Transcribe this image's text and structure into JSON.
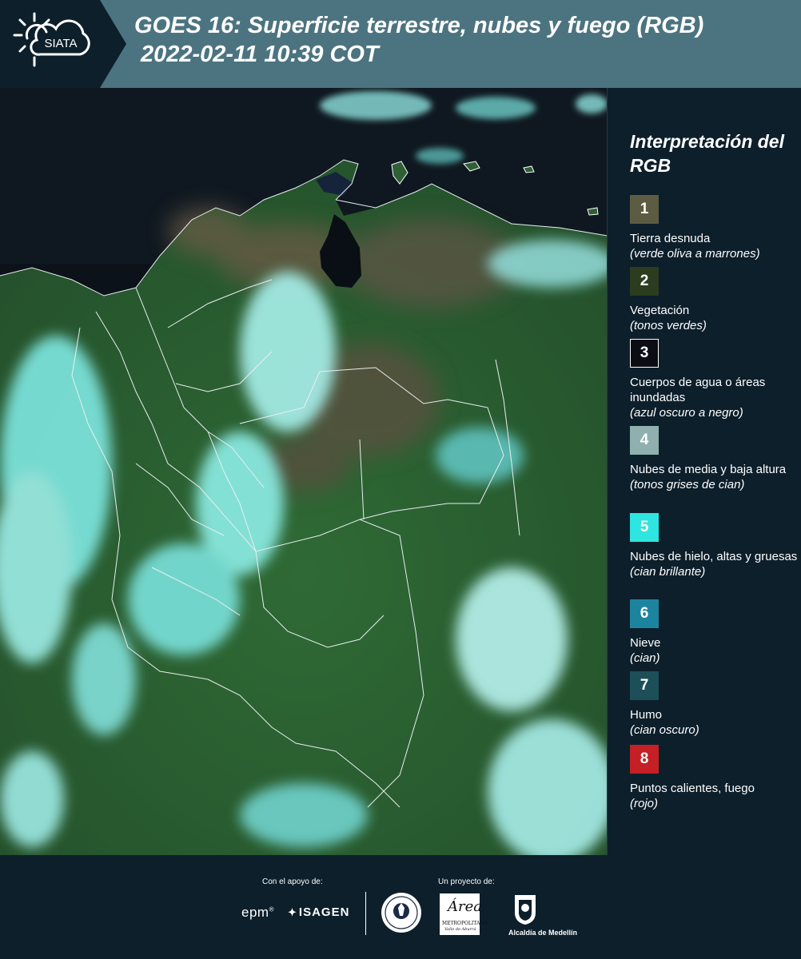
{
  "header": {
    "logo_text": "SIATA",
    "title_line1": "GOES 16: Superficie terrestre, nubes y fuego (RGB)",
    "title_line2": "2022-02-11 10:39 COT",
    "bg_color": "#4c7480"
  },
  "legend": {
    "title": "Interpretación del RGB",
    "items": [
      {
        "number": "1",
        "label": "Tierra desnuda",
        "sub": "(verde oliva a marrones)",
        "color": "#5c5c43"
      },
      {
        "number": "2",
        "label": "Vegetación",
        "sub": "(tonos verdes)",
        "color": "#2c3d1f"
      },
      {
        "number": "3",
        "label": "Cuerpos de agua o áreas inundadas",
        "sub": "(azul oscuro a negro)",
        "color": "#0a0e14"
      },
      {
        "number": "4",
        "label": "Nubes de media y baja altura",
        "sub": "(tonos grises de cian)",
        "color": "#8fb0ae"
      },
      {
        "number": "5",
        "label": "Nubes de hielo, altas y gruesas",
        "sub": "(cian brillante)",
        "color": "#2ee5df"
      },
      {
        "number": "6",
        "label": "Nieve",
        "sub": "(cian)",
        "color": "#1d84a0"
      },
      {
        "number": "7",
        "label": "Humo",
        "sub": "(cian oscuro)",
        "color": "#1c4f57"
      },
      {
        "number": "8",
        "label": "Puntos calientes, fuego",
        "sub": "(rojo)",
        "color": "#c42026"
      }
    ]
  },
  "footer": {
    "support_label": "Con el apoyo de:",
    "project_label": "Un proyecto de:",
    "sponsor_epm": "epm",
    "sponsor_isagen": "ISAGEN",
    "area_logo_text": "Área",
    "area_logo_sub": "METROPOLITANA",
    "area_logo_sub2": "Valle de Aburrá",
    "alcaldia_label": "Alcaldía de Medellín"
  }
}
